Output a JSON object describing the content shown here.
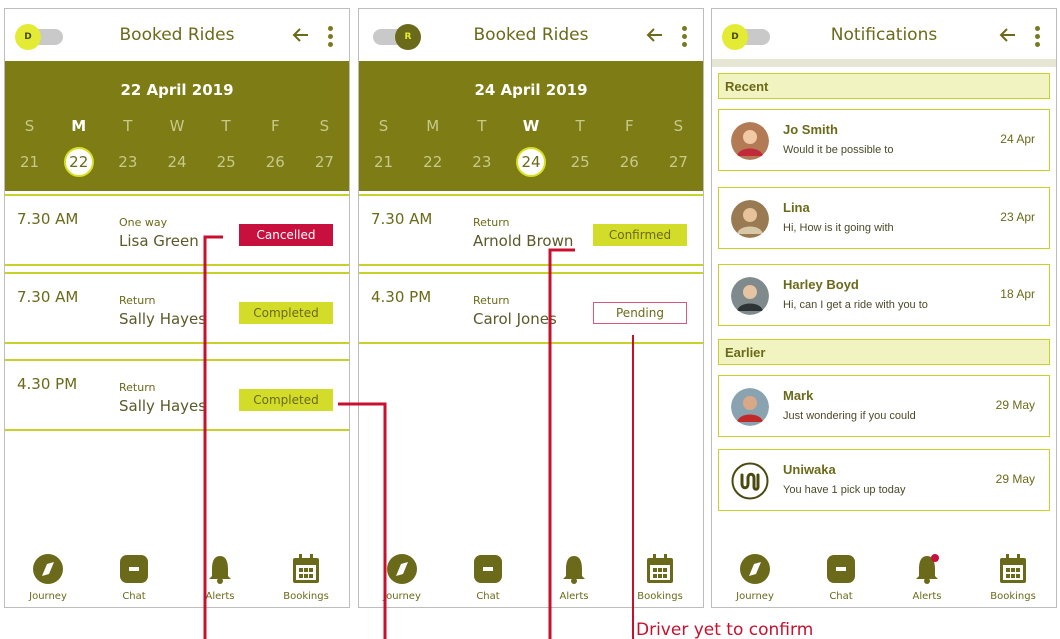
{
  "toggle": {
    "driver_letter": "D",
    "rider_letter": "R"
  },
  "screens": {
    "driver_bookings": {
      "title": "Booked Rides",
      "date": "22 April 2019",
      "weekdays": [
        "S",
        "M",
        "T",
        "W",
        "T",
        "F",
        "S"
      ],
      "days": [
        "21",
        "22",
        "23",
        "24",
        "25",
        "26",
        "27"
      ],
      "selected_day_index": 1,
      "rides": [
        {
          "time": "7.30 AM",
          "type": "One way",
          "name": "Lisa Green",
          "status": "Cancelled"
        },
        {
          "time": "7.30 AM",
          "type": "Return",
          "name": "Sally Hayes",
          "status": "Completed"
        },
        {
          "time": "4.30 PM",
          "type": "Return",
          "name": "Sally Hayes",
          "status": "Completed"
        }
      ]
    },
    "rider_bookings": {
      "title": "Booked Rides",
      "date": "24 April 2019",
      "weekdays": [
        "S",
        "M",
        "T",
        "W",
        "T",
        "F",
        "S"
      ],
      "days": [
        "21",
        "22",
        "23",
        "24",
        "25",
        "26",
        "27"
      ],
      "selected_day_index": 3,
      "rides": [
        {
          "time": "7.30 AM",
          "type": "Return",
          "name": "Arnold Brown",
          "status": "Confirmed"
        },
        {
          "time": "4.30 PM",
          "type": "Return",
          "name": "Carol Jones",
          "status": "Pending"
        }
      ]
    },
    "notifications": {
      "title": "Notifications",
      "recent_label": "Recent",
      "earlier_label": "Earlier",
      "recent": [
        {
          "name": "Jo Smith",
          "message": "Would it be possible to",
          "date": "24 Apr"
        },
        {
          "name": "Lina",
          "message": "Hi, How is it going with",
          "date": "23 Apr"
        },
        {
          "name": "Harley Boyd",
          "message": "Hi, can I get a ride with you to",
          "date": "18 Apr"
        }
      ],
      "earlier": [
        {
          "name": "Mark",
          "message": "Just wondering if you could",
          "date": "29 May"
        },
        {
          "name": "Uniwaka",
          "message": "You have 1 pick up today",
          "date": "29 May"
        }
      ]
    }
  },
  "bottom_nav": [
    "Journey",
    "Chat",
    "Alerts",
    "Bookings"
  ],
  "annotation": "Driver yet to confirm",
  "icons": [
    "back-arrow-icon",
    "more-vertical-icon",
    "compass-icon",
    "chat-icon",
    "bell-icon",
    "calendar-icon"
  ],
  "colors": {
    "olive": "#7d7c15",
    "lime": "#d4dc2a",
    "cancelled": "#c8103e",
    "annotation": "#c8102e"
  }
}
